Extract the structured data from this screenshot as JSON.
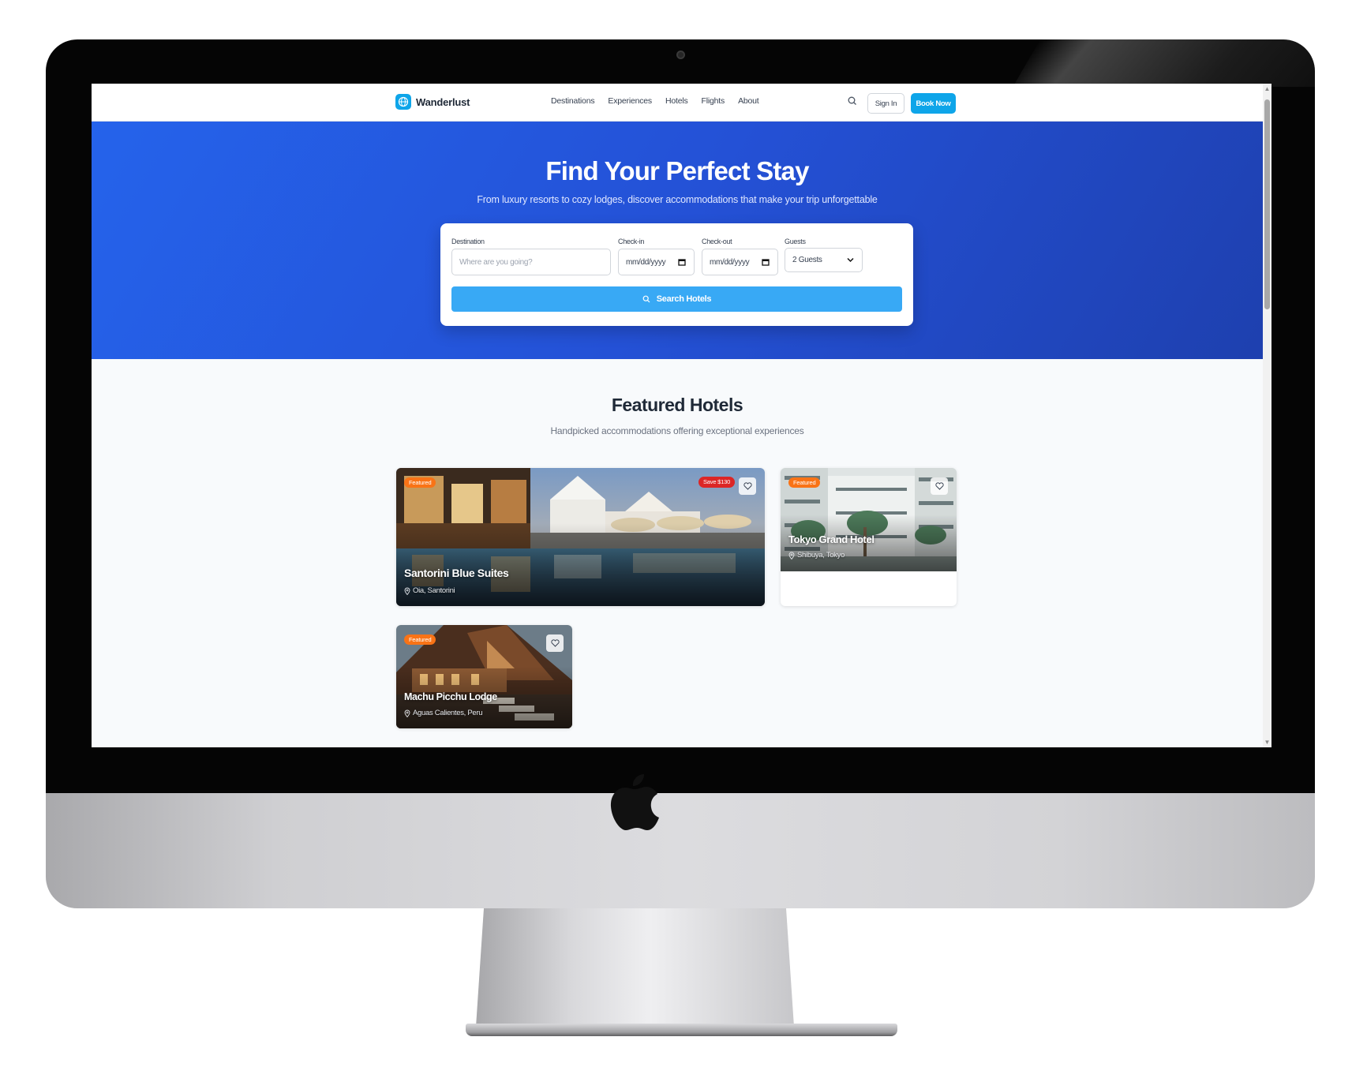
{
  "brand": {
    "name": "Wanderlust"
  },
  "nav": {
    "links": [
      "Destinations",
      "Experiences",
      "Hotels",
      "Flights",
      "About"
    ],
    "sign_in": "Sign In",
    "book_now": "Book Now"
  },
  "hero": {
    "title": "Find Your Perfect Stay",
    "subtitle": "From luxury resorts to cozy lodges, discover accommodations that make your trip unforgettable"
  },
  "search": {
    "destination_label": "Destination",
    "destination_placeholder": "Where are you going?",
    "checkin_label": "Check-in",
    "checkin_value": "mm/dd/yyyy",
    "checkout_label": "Check-out",
    "checkout_value": "mm/dd/yyyy",
    "guests_label": "Guests",
    "guests_value": "2 Guests",
    "button_label": "Search Hotels"
  },
  "featured": {
    "title": "Featured Hotels",
    "subtitle": "Handpicked accommodations offering exceptional experiences",
    "hotels": [
      {
        "badge": "Featured",
        "save": "Save $130",
        "name": "Santorini Blue Suites",
        "location": "Oia, Santorini"
      },
      {
        "badge": "Featured",
        "name": "Tokyo Grand Hotel",
        "location": "Shibuya, Tokyo"
      },
      {
        "badge": "Featured",
        "name": "Machu Picchu Lodge",
        "location": "Aguas Calientes, Peru"
      }
    ]
  },
  "colors": {
    "accent": "#0ea5e9",
    "hero_start": "#2563eb",
    "hero_end": "#1e40af",
    "featured_badge": "#f97316",
    "save_badge": "#dc2626"
  },
  "icons": [
    "globe-icon",
    "search-icon",
    "calendar-icon",
    "chevron-down-icon",
    "heart-icon",
    "map-pin-icon",
    "apple-logo"
  ]
}
